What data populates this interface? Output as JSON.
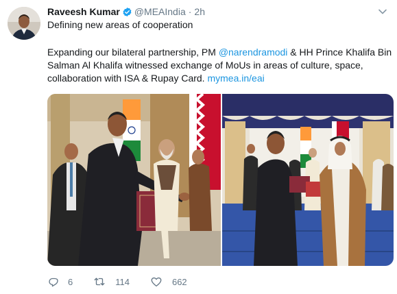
{
  "author": {
    "name": "Raveesh Kumar",
    "handle": "@MEAIndia",
    "separator": "·",
    "time": "2h"
  },
  "tweet": {
    "line1": "Defining new areas of cooperation",
    "para_l1_a": "Expanding our bilateral partnership, PM ",
    "mention_modi": "@narendramodi",
    "para_l1_b": " & HH Prince Khalifa Bin",
    "para_l2": "Salman Al Khalifa witnessed exchange of MoUs in areas of culture, space,",
    "para_l3_a": "collaboration with ISA & Rupay Card. ",
    "link": "mymea.in/eai"
  },
  "actions": {
    "replies": "6",
    "retweets": "114",
    "likes": "662"
  },
  "icons": {
    "verified": "verified-badge-icon",
    "more": "chevron-down-icon",
    "reply": "reply-icon",
    "retweet": "retweet-icon",
    "like": "heart-icon"
  },
  "colors": {
    "link": "#1b95e0",
    "secondary_text": "#657786",
    "verified": "#1da1f2"
  }
}
